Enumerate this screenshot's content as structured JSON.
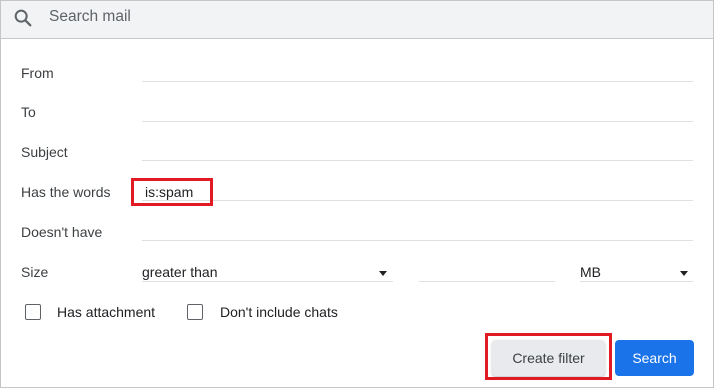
{
  "search": {
    "placeholder": "Search mail",
    "icon": "search-icon"
  },
  "fields": {
    "from": {
      "label": "From",
      "value": ""
    },
    "to": {
      "label": "To",
      "value": ""
    },
    "subject": {
      "label": "Subject",
      "value": ""
    },
    "has_words": {
      "label": "Has the words",
      "value": "is:spam"
    },
    "doesnt_have": {
      "label": "Doesn't have",
      "value": ""
    }
  },
  "size": {
    "label": "Size",
    "comparator": "greater than",
    "amount": "",
    "unit": "MB"
  },
  "checkboxes": {
    "has_attachment": {
      "label": "Has attachment",
      "checked": false
    },
    "dont_include_chats": {
      "label": "Don't include chats",
      "checked": false
    }
  },
  "buttons": {
    "create_filter": "Create filter",
    "search": "Search"
  },
  "colors": {
    "highlight": "#e01b24",
    "primary_button": "#1a73e8",
    "secondary_button": "#e8eaed"
  }
}
